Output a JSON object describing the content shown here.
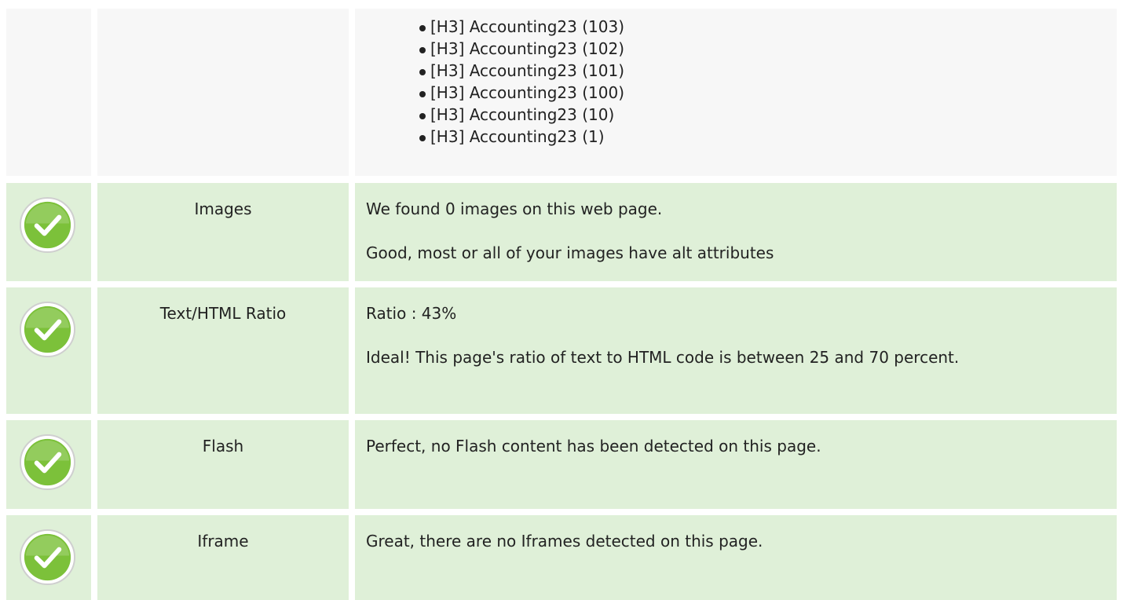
{
  "headings": {
    "items": [
      "[H3] Accounting23 (103)",
      "[H3] Accounting23 (102)",
      "[H3] Accounting23 (101)",
      "[H3] Accounting23 (100)",
      "[H3] Accounting23 (10)",
      "[H3] Accounting23 (1)"
    ]
  },
  "checks": {
    "images": {
      "label": "Images",
      "lines": [
        "We found 0 images on this web page.",
        "Good, most or all of your images have alt attributes"
      ],
      "icon": "check-circle-icon"
    },
    "ratio": {
      "label": "Text/HTML Ratio",
      "lines": [
        "Ratio : 43%",
        "Ideal! This page's ratio of text to HTML code is between 25 and 70 percent."
      ],
      "icon": "check-circle-icon"
    },
    "flash": {
      "label": "Flash",
      "lines": [
        "Perfect, no Flash content has been detected on this page."
      ],
      "icon": "check-circle-icon"
    },
    "iframe": {
      "label": "Iframe",
      "lines": [
        "Great, there are no Iframes detected on this page."
      ],
      "icon": "check-circle-icon"
    }
  },
  "colors": {
    "pass_row": "#dff0d8",
    "neutral_row": "#f7f7f7",
    "check_green": "#7cc13a"
  }
}
